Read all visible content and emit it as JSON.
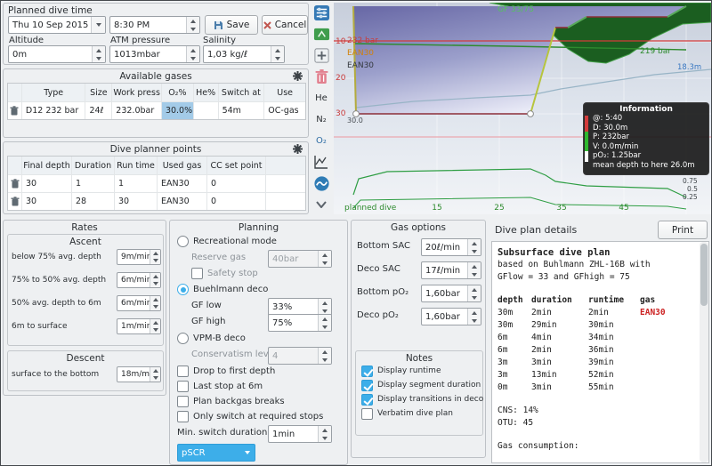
{
  "planned_dive": {
    "title": "Planned dive time",
    "date": "Thu 10 Sep 2015",
    "time": "8:30 PM",
    "save": "Save",
    "cancel": "Cancel",
    "altitude_label": "Altitude",
    "altitude": "0m",
    "atm_label": "ATM pressure",
    "atm": "1013mbar",
    "salinity_label": "Salinity",
    "salinity": "1,03 kg/ℓ"
  },
  "gases": {
    "title": "Available gases",
    "col_type": "Type",
    "col_size": "Size",
    "col_work": "Work press",
    "col_o2": "O₂%",
    "col_he": "He%",
    "col_switch": "Switch at",
    "col_use": "Use",
    "row0": {
      "type": "D12 232 bar",
      "size": "24ℓ",
      "work": "232.0bar",
      "o2": "30.0%",
      "he": "",
      "switch": "54m",
      "use": "OC-gas"
    }
  },
  "points": {
    "title": "Dive planner points",
    "col_depth": "Final depth",
    "col_duration": "Duration",
    "col_runtime": "Run time",
    "col_gas": "Used gas",
    "col_ccsp": "CC set point",
    "row0": {
      "depth": "30",
      "duration": "1",
      "runtime": "1",
      "gas": "EAN30",
      "ccsp": "0"
    },
    "row1": {
      "depth": "30",
      "duration": "28",
      "runtime": "30",
      "gas": "EAN30",
      "ccsp": "0"
    }
  },
  "rates": {
    "title": "Rates",
    "ascent_title": "Ascent",
    "r0_label": "below 75% avg. depth",
    "r0_value": "9m/min",
    "r1_label": "75% to 50% avg. depth",
    "r1_value": "6m/min",
    "r2_label": "50% avg. depth to 6m",
    "r2_value": "6m/min",
    "r3_label": "6m to surface",
    "r3_value": "1m/min",
    "descent_title": "Descent",
    "d0_label": "surface to the bottom",
    "d0_value": "18m/min"
  },
  "planning": {
    "title": "Planning",
    "recreational": "Recreational mode",
    "reserve_label": "Reserve gas",
    "reserve_value": "40bar",
    "safety_stop": "Safety stop",
    "buehlmann": "Buehlmann deco",
    "gf_low_label": "GF low",
    "gf_low": "33%",
    "gf_high_label": "GF high",
    "gf_high": "75%",
    "vpmb": "VPM-B deco",
    "conservatism_label": "Conservatism level",
    "conservatism": "4",
    "drop_first": "Drop to first depth",
    "last_stop": "Last stop at 6m",
    "backgas": "Plan backgas breaks",
    "only_switch": "Only switch at required stops",
    "min_switch_label": "Min. switch duration",
    "min_switch": "1min",
    "dive_mode": "pSCR"
  },
  "gas_options": {
    "title": "Gas options",
    "bottom_sac_label": "Bottom SAC",
    "bottom_sac": "20ℓ/min",
    "deco_sac_label": "Deco SAC",
    "deco_sac": "17ℓ/min",
    "bottom_po2_label": "Bottom pO₂",
    "bottom_po2": "1,60bar",
    "deco_po2_label": "Deco pO₂",
    "deco_po2": "1,60bar",
    "notes_title": "Notes",
    "n0": "Display runtime",
    "n1": "Display segment duration",
    "n2": "Display transitions in deco",
    "n3": "Verbatim dive plan"
  },
  "details": {
    "title": "Dive plan details",
    "print": "Print",
    "heading": "Subsurface dive plan",
    "basis1": "based on Buhlmann ZHL-16B with",
    "basis2": "GFlow = 33 and GFhigh = 75",
    "th_depth": "depth",
    "th_duration": "duration",
    "th_runtime": "runtime",
    "th_gas": "gas",
    "rows": [
      {
        "depth": "30m",
        "duration": "2min",
        "runtime": "2min",
        "gas": "EAN30"
      },
      {
        "depth": "30m",
        "duration": "29min",
        "runtime": "30min",
        "gas": ""
      },
      {
        "depth": "6m",
        "duration": "4min",
        "runtime": "34min",
        "gas": ""
      },
      {
        "depth": "6m",
        "duration": "2min",
        "runtime": "36min",
        "gas": ""
      },
      {
        "depth": "3m",
        "duration": "3min",
        "runtime": "39min",
        "gas": ""
      },
      {
        "depth": "3m",
        "duration": "13min",
        "runtime": "52min",
        "gas": ""
      },
      {
        "depth": "0m",
        "duration": "3min",
        "runtime": "55min",
        "gas": ""
      }
    ],
    "cns": "CNS: 14%",
    "otu": "OTU: 45",
    "gas_consumption": "Gas consumption:"
  },
  "toolbar": {
    "he": "He",
    "n2": "N₂",
    "o2": "O₂"
  },
  "chart": {
    "gf_label": "GF 33/75",
    "start_pressure": "232 bar",
    "end_pressure": "219 bar",
    "mean_depth_label": "18.3m",
    "gas_label_1": "EAN30",
    "gas_label_2": "EAN30",
    "first_point_depth": "30.0",
    "depth_ticks": [
      "10",
      "20",
      "30"
    ],
    "time_ticks": [
      "15",
      "25",
      "35",
      "45"
    ],
    "planned_dive_label": "planned dive",
    "pp_scale": [
      "0.75",
      "0.5",
      "0.25"
    ],
    "profile": {
      "type": "line",
      "x_unit": "min",
      "y_unit": "m",
      "waypoints_time_min": [
        0,
        2,
        30,
        34,
        36,
        39,
        52,
        55
      ],
      "waypoints_depth_m": [
        0,
        30,
        30,
        6,
        6,
        3,
        3,
        0
      ]
    },
    "info": {
      "title": "Information",
      "l0": "@: 5:40",
      "l1": "D: 30.0m",
      "l2": "P: 232bar",
      "l3": "V: 0.0m/min",
      "l4": "pO₂: 1.25bar",
      "l5": "mean depth to here 26.0m"
    }
  }
}
